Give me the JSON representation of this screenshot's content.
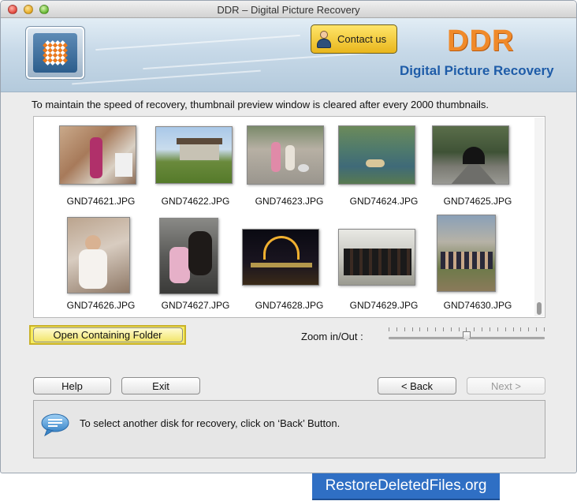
{
  "window": {
    "title": "DDR – Digital Picture Recovery"
  },
  "header": {
    "contact_label": "Contact us",
    "brand": "DDR",
    "brand_sub": "Digital Picture Recovery",
    "brand_color": "#f08a2a",
    "brand_sub_color": "#1e5ca8"
  },
  "notice": "To maintain the speed of recovery, thumbnail preview window is cleared after every 2000 thumbnails.",
  "thumbnails": [
    {
      "name": "GND74621.JPG",
      "scene": "indoor room, child in costume"
    },
    {
      "name": "GND74622.JPG",
      "scene": "large house with lawn"
    },
    {
      "name": "GND74623.JPG",
      "scene": "children playing outdoors"
    },
    {
      "name": "GND74624.JPG",
      "scene": "river rafting"
    },
    {
      "name": "GND74625.JPG",
      "scene": "road tunnel"
    },
    {
      "name": "GND74626.JPG",
      "scene": "baby in white"
    },
    {
      "name": "GND74627.JPG",
      "scene": "girl with big dog"
    },
    {
      "name": "GND74628.JPG",
      "scene": "city lights at night"
    },
    {
      "name": "GND74629.JPG",
      "scene": "group of women"
    },
    {
      "name": "GND74630.JPG",
      "scene": "group photo under trees"
    }
  ],
  "actions": {
    "open_folder": "Open Containing Folder",
    "zoom_label": "Zoom in/Out :",
    "zoom_level": 0.5
  },
  "buttons": {
    "help": "Help",
    "exit": "Exit",
    "back": "< Back",
    "next": "Next >"
  },
  "status": {
    "message": "To select another disk for recovery, click on ‘Back’ Button."
  },
  "watermark": "RestoreDeletedFiles.org"
}
